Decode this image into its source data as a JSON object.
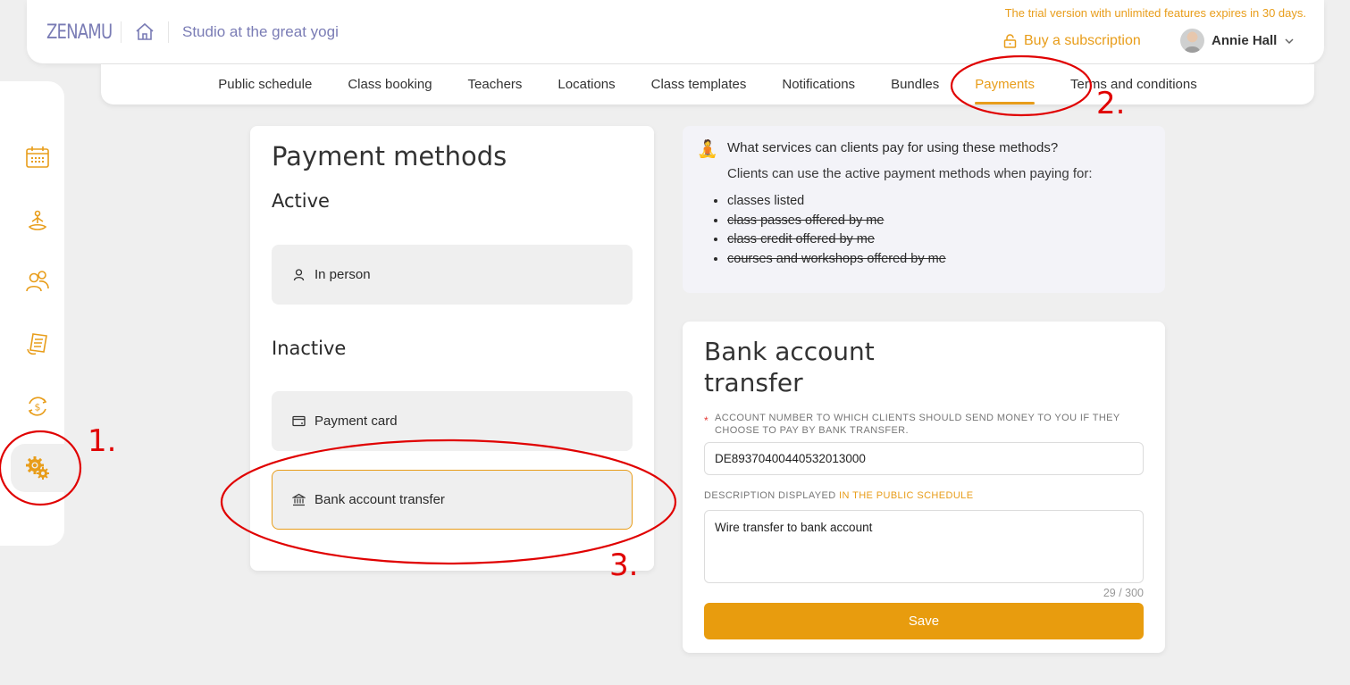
{
  "header": {
    "logo": "ZENAMU",
    "studio_name": "Studio at the great yogi",
    "trial_notice": "The trial version with unlimited features expires in 30 days.",
    "buy_subscription": "Buy a subscription",
    "user_name": "Annie Hall"
  },
  "tabs": [
    {
      "label": "Public schedule",
      "active": false
    },
    {
      "label": "Class booking",
      "active": false
    },
    {
      "label": "Teachers",
      "active": false
    },
    {
      "label": "Locations",
      "active": false
    },
    {
      "label": "Class templates",
      "active": false
    },
    {
      "label": "Notifications",
      "active": false
    },
    {
      "label": "Bundles",
      "active": false
    },
    {
      "label": "Payments",
      "active": true
    },
    {
      "label": "Terms and conditions",
      "active": false
    }
  ],
  "sidebar": {
    "items": [
      {
        "icon": "calendar-icon"
      },
      {
        "icon": "yoga-icon"
      },
      {
        "icon": "users-icon"
      },
      {
        "icon": "document-icon"
      },
      {
        "icon": "payment-cycle-icon"
      },
      {
        "icon": "settings-gears-icon",
        "active": true
      }
    ]
  },
  "payment_methods": {
    "title": "Payment methods",
    "active_title": "Active",
    "inactive_title": "Inactive",
    "active": [
      {
        "label": "In person",
        "icon": "person-icon"
      }
    ],
    "inactive": [
      {
        "label": "Payment card",
        "icon": "card-icon"
      },
      {
        "label": "Bank account transfer",
        "icon": "bank-icon",
        "selected": true
      }
    ]
  },
  "info": {
    "icon": "🧘",
    "title": "What services can clients pay for using these methods?",
    "subtitle": "Clients can use the active payment methods when paying for:",
    "items": [
      {
        "text": "classes listed",
        "struck": false
      },
      {
        "text": "class passes offered by me",
        "struck": true
      },
      {
        "text": "class credit offered by me",
        "struck": true
      },
      {
        "text": "courses and workshops offered by me",
        "struck": true
      }
    ]
  },
  "bank_form": {
    "title": "Bank account transfer",
    "account_label": "ACCOUNT NUMBER TO WHICH CLIENTS SHOULD SEND MONEY TO YOU IF THEY CHOOSE TO PAY BY BANK TRANSFER.",
    "account_value": "DE89370400440532013000",
    "desc_label_prefix": "DESCRIPTION DISPLAYED ",
    "desc_label_highlight": "IN THE PUBLIC SCHEDULE",
    "desc_value": "Wire transfer to bank account",
    "counter": "29 / 300",
    "save_label": "Save"
  },
  "annotations": [
    "1.",
    "2.",
    "3."
  ],
  "colors": {
    "accent": "#e89d1a",
    "brand": "#7a7cb5",
    "annotation": "#e00000"
  }
}
